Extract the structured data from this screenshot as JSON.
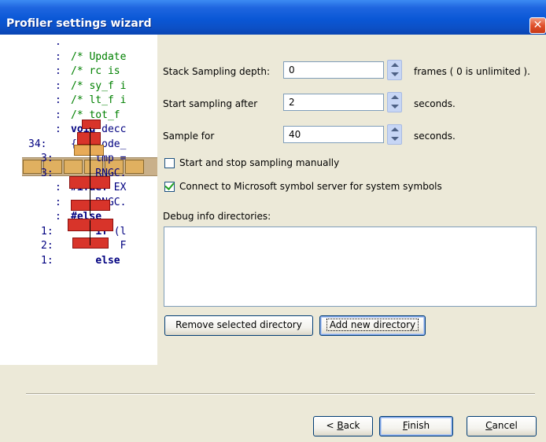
{
  "window": {
    "title": "Profiler settings wizard"
  },
  "illustration": {
    "code_lines": [
      {
        "prefix": ".",
        "text": ""
      },
      {
        "prefix": ":",
        "text": "/* Update"
      },
      {
        "prefix": ":",
        "text": "/* rc is"
      },
      {
        "prefix": ":",
        "text": "/* sy_f i"
      },
      {
        "prefix": ":",
        "text": "/* lt_f i"
      },
      {
        "prefix": ":",
        "text": "/* tot_f"
      },
      {
        "prefix": ":",
        "text": "void decc"
      },
      {
        "prefix": "34:",
        "text": "{   code_"
      },
      {
        "prefix": "3:",
        "text": "    tmp ="
      },
      {
        "prefix": "3:",
        "text": "    RNGC."
      },
      {
        "prefix": ":",
        "text": "#ifdef EX"
      },
      {
        "prefix": ":",
        "text": "    RNGC."
      },
      {
        "prefix": ":",
        "text": "#else"
      },
      {
        "prefix": "1:",
        "text": "    if (l"
      },
      {
        "prefix": "2:",
        "text": "        F"
      },
      {
        "prefix": "1:",
        "text": "    else"
      }
    ]
  },
  "form": {
    "stack_depth": {
      "label": "Stack Sampling depth:",
      "value": "0",
      "unit": "frames ( 0 is unlimited )."
    },
    "start_after": {
      "label": "Start sampling after",
      "value": "2",
      "unit": "seconds."
    },
    "sample_for": {
      "label": "Sample for",
      "value": "40",
      "unit": "seconds."
    },
    "manual_sampling": {
      "label": "Start and stop sampling manually",
      "checked": false
    },
    "symbol_server": {
      "label": "Connect to Microsoft symbol server for system symbols",
      "checked": true
    },
    "debug_dirs_label": "Debug info directories:",
    "debug_dirs": []
  },
  "buttons": {
    "remove_dir": "Remove selected directory",
    "add_dir": "Add new directory",
    "back_prefix": "< ",
    "back_key": "B",
    "back_rest": "ack",
    "finish_key": "F",
    "finish_rest": "inish",
    "cancel_key": "C",
    "cancel_rest": "ancel"
  },
  "icons": {
    "close": "close-icon",
    "spin": "spin-up-down-icon",
    "check": "checkmark-icon"
  },
  "colors": {
    "titlebar": "#0a57d6",
    "dialog_bg": "#ece9d8",
    "close": "#e0502b",
    "check": "#21a121",
    "accent_red": "#d8342a"
  }
}
